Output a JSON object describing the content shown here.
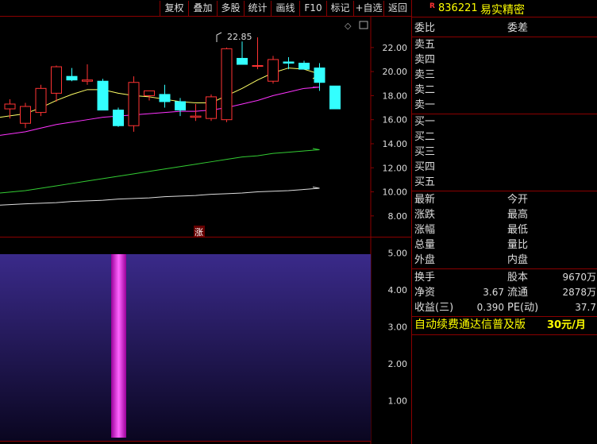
{
  "toolbar": {
    "buttons": [
      "复权",
      "叠加",
      "多股",
      "统计",
      "画线",
      "F10",
      "标记",
      "+自选",
      "返回"
    ]
  },
  "chart_data": {
    "type": "candlestick",
    "price_axis": {
      "ticks": [
        "22.00",
        "20.00",
        "18.00",
        "16.00",
        "14.00",
        "12.00",
        "10.00",
        "8.00"
      ],
      "range": [
        6.8,
        24.3
      ]
    },
    "volume_axis": {
      "ticks": [
        "5.00",
        "4.00",
        "3.00",
        "2.00",
        "1.00"
      ],
      "range": [
        0,
        5.4
      ]
    },
    "candles": [
      {
        "o": 16.9,
        "h": 17.7,
        "l": 16.1,
        "c": 17.3
      },
      {
        "o": 15.7,
        "h": 17.4,
        "l": 15.3,
        "c": 17.1
      },
      {
        "o": 16.6,
        "h": 18.9,
        "l": 16.3,
        "c": 18.6
      },
      {
        "o": 18.2,
        "h": 20.5,
        "l": 17.5,
        "c": 20.4
      },
      {
        "o": 19.6,
        "h": 20.3,
        "l": 19.2,
        "c": 19.3
      },
      {
        "o": 19.2,
        "h": 20.6,
        "l": 18.9,
        "c": 19.3
      },
      {
        "o": 19.2,
        "h": 19.4,
        "l": 16.9,
        "c": 16.8
      },
      {
        "o": 16.8,
        "h": 17.0,
        "l": 15.4,
        "c": 15.5
      },
      {
        "o": 15.5,
        "h": 19.6,
        "l": 15.0,
        "c": 19.1
      },
      {
        "o": 18.0,
        "h": 18.4,
        "l": 17.6,
        "c": 18.4
      },
      {
        "o": 18.1,
        "h": 18.9,
        "l": 17.0,
        "c": 17.5
      },
      {
        "o": 17.5,
        "h": 17.8,
        "l": 16.3,
        "c": 16.8
      },
      {
        "o": 16.2,
        "h": 17.3,
        "l": 15.9,
        "c": 16.3
      },
      {
        "o": 16.1,
        "h": 18.1,
        "l": 15.9,
        "c": 17.9
      },
      {
        "o": 16.0,
        "h": 22.0,
        "l": 15.8,
        "c": 21.9
      },
      {
        "o": 21.1,
        "h": 22.5,
        "l": 20.9,
        "c": 20.6
      },
      {
        "o": 20.5,
        "h": 22.85,
        "l": 20.2,
        "c": 20.5
      },
      {
        "o": 19.2,
        "h": 21.3,
        "l": 19.0,
        "c": 21.0
      },
      {
        "o": 20.8,
        "h": 21.2,
        "l": 20.2,
        "c": 20.7
      },
      {
        "o": 20.7,
        "h": 20.9,
        "l": 20.3,
        "c": 20.2
      },
      {
        "o": 20.3,
        "h": 20.7,
        "l": 18.4,
        "c": 19.1
      },
      {
        "o": 18.8,
        "h": 18.8,
        "l": 17.0,
        "c": 16.9
      }
    ],
    "high_label": "22.85",
    "ma_series": [
      {
        "color": "#ffff66",
        "values": [
          16.2,
          16.5,
          17.0,
          17.6,
          18.1,
          18.5,
          18.5,
          18.2,
          18.0,
          17.9,
          17.7,
          17.5,
          17.4,
          17.4,
          18.0,
          18.6,
          19.3,
          19.9,
          20.3,
          20.2,
          19.8,
          19.4
        ]
      },
      {
        "color": "#ff33ff",
        "values": [
          14.7,
          15.0,
          15.3,
          15.6,
          15.8,
          16.0,
          16.2,
          16.3,
          16.4,
          16.5,
          16.6,
          16.7,
          16.7,
          16.8,
          17.0,
          17.3,
          17.6,
          18.0,
          18.3,
          18.6,
          18.7,
          18.7
        ]
      },
      {
        "color": "#33cc33",
        "values": [
          9.9,
          10.1,
          10.3,
          10.5,
          10.7,
          10.9,
          11.1,
          11.3,
          11.5,
          11.7,
          11.9,
          12.1,
          12.3,
          12.5,
          12.7,
          12.9,
          13.0,
          13.2,
          13.3,
          13.4,
          13.5,
          13.6
        ]
      },
      {
        "color": "#dddddd",
        "values": [
          8.9,
          9.0,
          9.05,
          9.1,
          9.2,
          9.25,
          9.3,
          9.4,
          9.45,
          9.5,
          9.6,
          9.65,
          9.7,
          9.8,
          9.85,
          9.9,
          10.0,
          10.05,
          10.1,
          10.2,
          10.3,
          10.4
        ]
      }
    ],
    "volume_marker": "涨"
  },
  "panel": {
    "badge": "R",
    "code": "836221",
    "name": "易实精密",
    "header_left": "委比",
    "header_right": "委差",
    "sell_levels": [
      "卖五",
      "卖四",
      "卖三",
      "卖二",
      "卖一"
    ],
    "buy_levels": [
      "买一",
      "买二",
      "买三",
      "买四",
      "买五"
    ],
    "quote_left": [
      "最新",
      "涨跌",
      "涨幅",
      "总量",
      "外盘"
    ],
    "quote_right": [
      "今开",
      "最高",
      "最低",
      "量比",
      "内盘"
    ],
    "fund": [
      {
        "l": "换手",
        "lv": "",
        "m": "股本",
        "mv": "9670万"
      },
      {
        "l": "净资",
        "lv": "3.67",
        "m": "流通",
        "mv": "2878万"
      },
      {
        "l": "收益(三)",
        "lv": "0.390",
        "m": "PE(动)",
        "mv": "37.7"
      }
    ],
    "ad_text": "自动续费通达信普及版",
    "ad_price": "30元/月"
  },
  "colors": {
    "border": "#8b0000",
    "up": "#ff3333",
    "down": "#33ffff",
    "ad": "#ffff00"
  }
}
